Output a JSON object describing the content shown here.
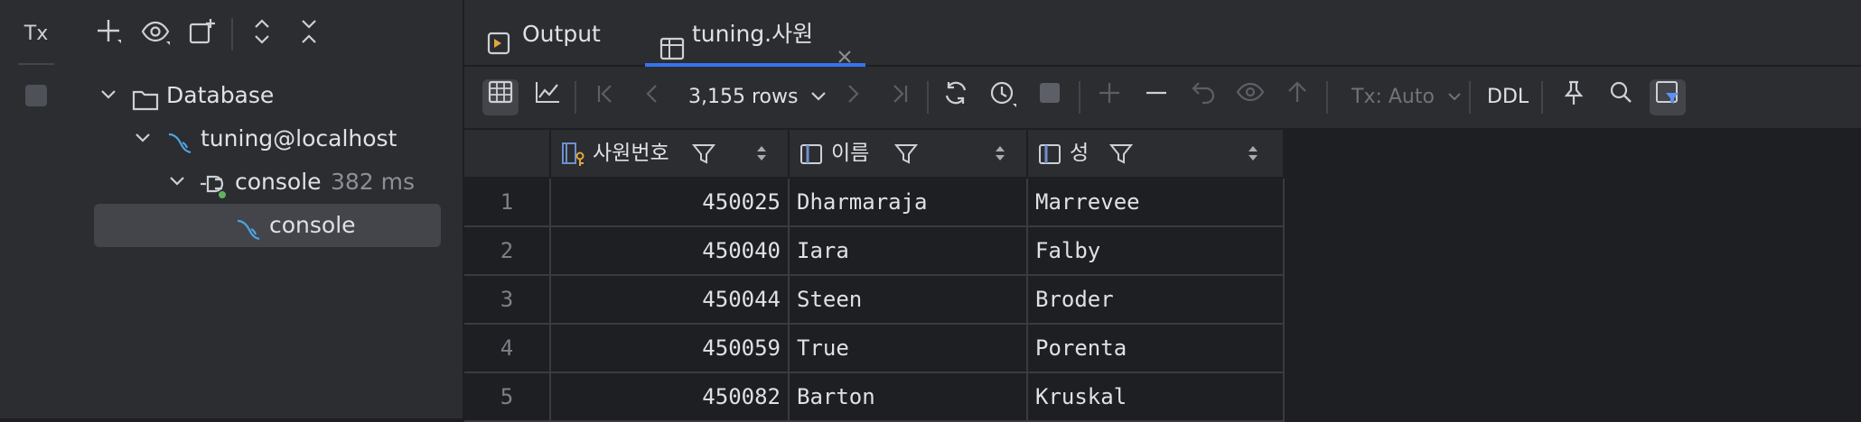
{
  "left_panel": {
    "tx_label": "Tx",
    "tree": [
      {
        "label": "Database",
        "sub": ""
      },
      {
        "label": "tuning@localhost",
        "sub": ""
      },
      {
        "label": "console",
        "sub": "382 ms"
      },
      {
        "label": "console",
        "sub": ""
      }
    ]
  },
  "tabs": [
    {
      "label": "Output"
    },
    {
      "label": "tuning.사원"
    }
  ],
  "toolbar": {
    "rows_label": "3,155 rows",
    "tx_mode": "Tx: Auto",
    "ddl_label": "DDL"
  },
  "table": {
    "columns": [
      "사원번호",
      "이름",
      "성"
    ],
    "rows": [
      {
        "n": "1",
        "id": "450025",
        "first": "Dharmaraja",
        "last": "Marrevee"
      },
      {
        "n": "2",
        "id": "450040",
        "first": "Iara",
        "last": "Falby"
      },
      {
        "n": "3",
        "id": "450044",
        "first": "Steen",
        "last": "Broder"
      },
      {
        "n": "4",
        "id": "450059",
        "first": "True",
        "last": "Porenta"
      },
      {
        "n": "5",
        "id": "450082",
        "first": "Barton",
        "last": "Kruskal"
      }
    ]
  },
  "colors": {
    "accent": "#3574f0",
    "panel": "#2b2d30",
    "background": "#1e1f22"
  }
}
